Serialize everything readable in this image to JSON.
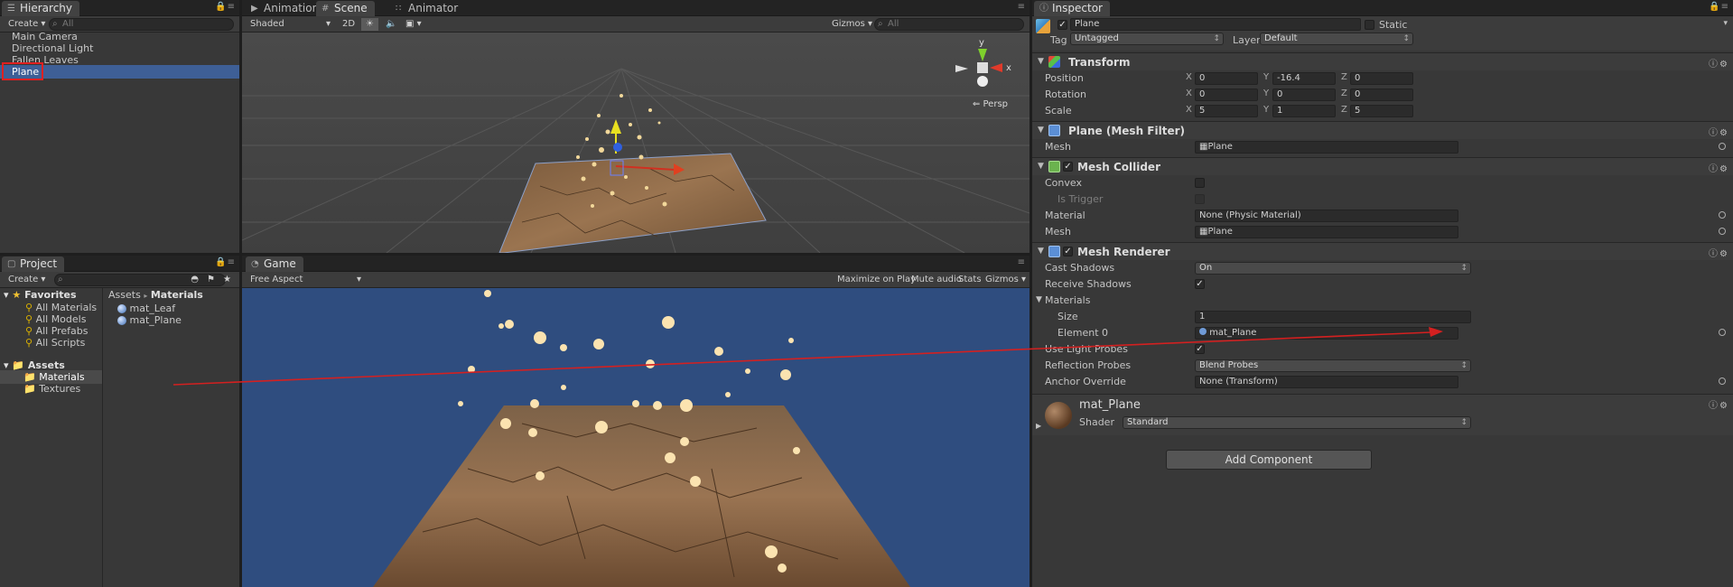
{
  "hierarchy": {
    "tab": "Hierarchy",
    "create": "Create",
    "search_placeholder": "All",
    "items": [
      "Main Camera",
      "Directional Light",
      "Fallen Leaves",
      "Plane"
    ]
  },
  "scene": {
    "tabs": [
      "Animation",
      "Scene",
      "Animator"
    ],
    "shading": "Shaded",
    "mode_2d": "2D",
    "gizmos": "Gizmos",
    "search_placeholder": "All",
    "persp": "Persp",
    "axis_y": "y",
    "axis_x": "x"
  },
  "project": {
    "tab": "Project",
    "create": "Create",
    "favorites_label": "Favorites",
    "favorites": [
      "All Materials",
      "All Models",
      "All Prefabs",
      "All Scripts"
    ],
    "assets_label": "Assets",
    "folders": [
      "Materials",
      "Textures"
    ],
    "breadcrumb_root": "Assets",
    "breadcrumb_sep": "▸",
    "breadcrumb_current": "Materials",
    "files": [
      "mat_Leaf",
      "mat_Plane"
    ]
  },
  "game": {
    "tab": "Game",
    "aspect": "Free Aspect",
    "maximize": "Maximize on Play",
    "mute": "Mute audio",
    "stats": "Stats",
    "gizmos": "Gizmos"
  },
  "inspector": {
    "tab": "Inspector",
    "object_name": "Plane",
    "static_label": "Static",
    "tag_label": "Tag",
    "tag_value": "Untagged",
    "layer_label": "Layer",
    "layer_value": "Default",
    "transform": {
      "title": "Transform",
      "position_label": "Position",
      "rotation_label": "Rotation",
      "scale_label": "Scale",
      "position": {
        "x": "0",
        "y": "-16.4",
        "z": "0"
      },
      "rotation": {
        "x": "0",
        "y": "0",
        "z": "0"
      },
      "scale": {
        "x": "5",
        "y": "1",
        "z": "5"
      },
      "axis_x": "X",
      "axis_y": "Y",
      "axis_z": "Z"
    },
    "mesh_filter": {
      "title": "Plane (Mesh Filter)",
      "mesh_label": "Mesh",
      "mesh_value": "Plane"
    },
    "mesh_collider": {
      "title": "Mesh Collider",
      "convex_label": "Convex",
      "trigger_label": "Is Trigger",
      "material_label": "Material",
      "material_value": "None (Physic Material)",
      "mesh_label": "Mesh",
      "mesh_value": "Plane"
    },
    "mesh_renderer": {
      "title": "Mesh Renderer",
      "cast_label": "Cast Shadows",
      "cast_value": "On",
      "receive_label": "Receive Shadows",
      "materials_label": "Materials",
      "size_label": "Size",
      "size_value": "1",
      "element_label": "Element 0",
      "element_value": "mat_Plane",
      "light_probes_label": "Use Light Probes",
      "reflection_label": "Reflection Probes",
      "reflection_value": "Blend Probes",
      "anchor_label": "Anchor Override",
      "anchor_value": "None (Transform)"
    },
    "material": {
      "name": "mat_Plane",
      "shader_label": "Shader",
      "shader_value": "Standard"
    },
    "add_component": "Add Component"
  },
  "colors": {
    "selection": "#3e5f96",
    "highlight_box": "#e02020",
    "arrow": "#d42020",
    "game_bg": "#2f4d7f"
  }
}
